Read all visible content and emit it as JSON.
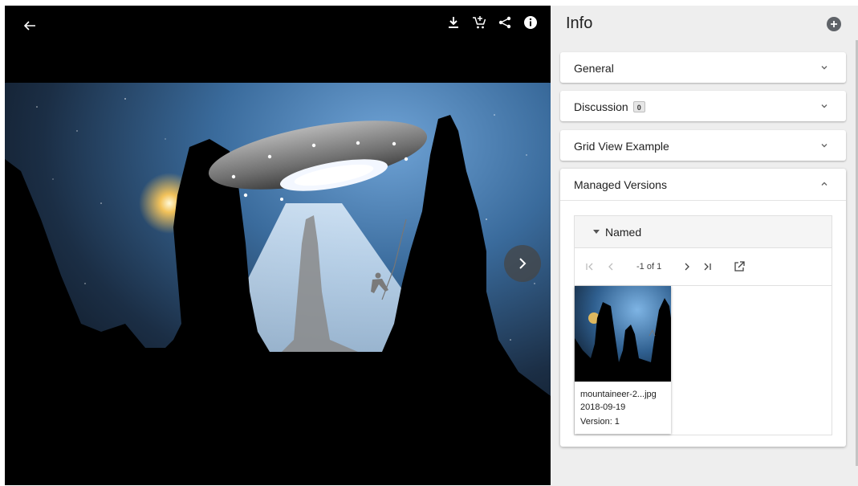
{
  "viewer": {
    "icons": {
      "back": "arrow-left-icon",
      "download": "download-icon",
      "cart": "add-to-cart-icon",
      "share": "share-icon",
      "info": "info-icon",
      "next": "chevron-right-icon"
    }
  },
  "info_panel": {
    "title": "Info",
    "add_icon": "plus-circle-icon",
    "sections": [
      {
        "label": "General",
        "expanded": false
      },
      {
        "label": "Discussion",
        "badge": "0",
        "expanded": false
      },
      {
        "label": "Grid View Example",
        "expanded": false
      },
      {
        "label": "Managed Versions",
        "expanded": true
      }
    ],
    "managed_versions": {
      "group_label": "Named",
      "pager": {
        "text": "-1 of 1",
        "first_icon": "first-page-icon",
        "prev_icon": "chevron-left-icon",
        "next_icon": "chevron-right-icon",
        "last_icon": "last-page-icon",
        "open_icon": "open-external-icon"
      },
      "items": [
        {
          "filename": "mountaineer-2...jpg",
          "date": "2018-09-19",
          "version": "Version: 1"
        }
      ]
    }
  },
  "colors": {
    "panel_bg": "#eeeeee",
    "viewer_bg": "#000000",
    "accent_icon": "#5f6368"
  }
}
